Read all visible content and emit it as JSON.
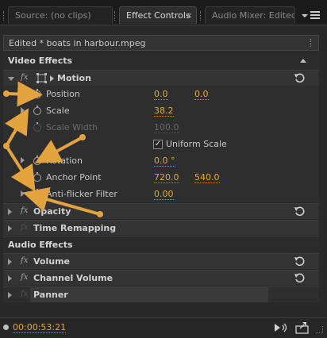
{
  "tabs": [
    {
      "label": "Source: (no clips)"
    },
    {
      "label": "Effect Controls",
      "close": "×"
    },
    {
      "label": "Audio Mixer: Edited"
    }
  ],
  "panel_menu_icon": "panel-menu-icon",
  "clip_title": "Edited * boats in harbour.mpeg",
  "sections": {
    "video": "Video Effects",
    "audio": "Audio Effects"
  },
  "motion": {
    "fx": "fx",
    "name": "Motion",
    "position_label": "Position",
    "position_x": "0.0",
    "position_y": "0.0",
    "scale_label": "Scale",
    "scale_value": "38.2",
    "scale_width_label": "Scale Width",
    "scale_width_value": "100.0",
    "uniform_label": "Uniform Scale",
    "uniform_checked": "✓",
    "rotation_label": "Rotation",
    "rotation_value": "0.0 °",
    "anchor_label": "Anchor Point",
    "anchor_x": "720.0",
    "anchor_y": "540.0",
    "antiflicker_label": "Anti-flicker Filter",
    "antiflicker_value": "0.00"
  },
  "video_effects": [
    {
      "fx": "fx",
      "name": "Opacity"
    },
    {
      "fx": "fx",
      "name": "Time Remapping"
    }
  ],
  "audio_effects": [
    {
      "fx": "fx",
      "name": "Volume"
    },
    {
      "fx": "fx",
      "name": "Channel Volume"
    },
    {
      "fx": "fx",
      "name": "Panner"
    }
  ],
  "footer": {
    "timecode": "00:00:53:21"
  },
  "colors": {
    "accent_value": "#e0a93a",
    "annotation_arrow": "#e3a43f"
  }
}
